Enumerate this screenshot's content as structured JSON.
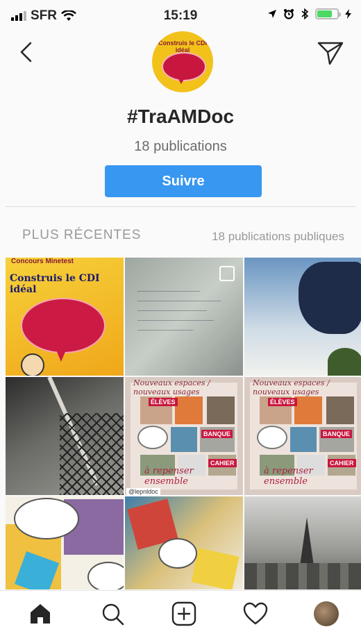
{
  "status_bar": {
    "carrier": "SFR",
    "time": "15:19",
    "battery_color": "#4cd964"
  },
  "header": {
    "back_icon": "chevron-left-icon",
    "share_icon": "paper-plane-icon",
    "avatar_text": "Construis le CDI idéal"
  },
  "profile": {
    "hashtag": "#TraAMDoc",
    "publications": "18 publications",
    "follow_label": "Suivre",
    "follow_color": "#3897f0"
  },
  "tabs": {
    "recent_label": "PLUS RÉCENTES",
    "public_label": "18 publications publiques"
  },
  "grid": {
    "tile1": {
      "header": "Concours Minetest",
      "title": "Construis le CDI idéal"
    },
    "tile5": {
      "heading": "Nouveaux espaces / nouveaux usages",
      "footer": "à repenser ensemble",
      "labels": [
        "ÉLÈVES",
        "BANQUE",
        "CAHIER"
      ],
      "badge": "@lepnldoc"
    },
    "tile6": {
      "heading": "Nouveaux espaces / nouveaux usages",
      "footer": "à repenser ensemble",
      "labels": [
        "ÉLÈVES",
        "BANQUE",
        "CAHIER"
      ]
    }
  },
  "tab_bar": {
    "items": [
      "home-icon",
      "search-icon",
      "add-post-icon",
      "heart-icon",
      "profile-avatar"
    ]
  }
}
